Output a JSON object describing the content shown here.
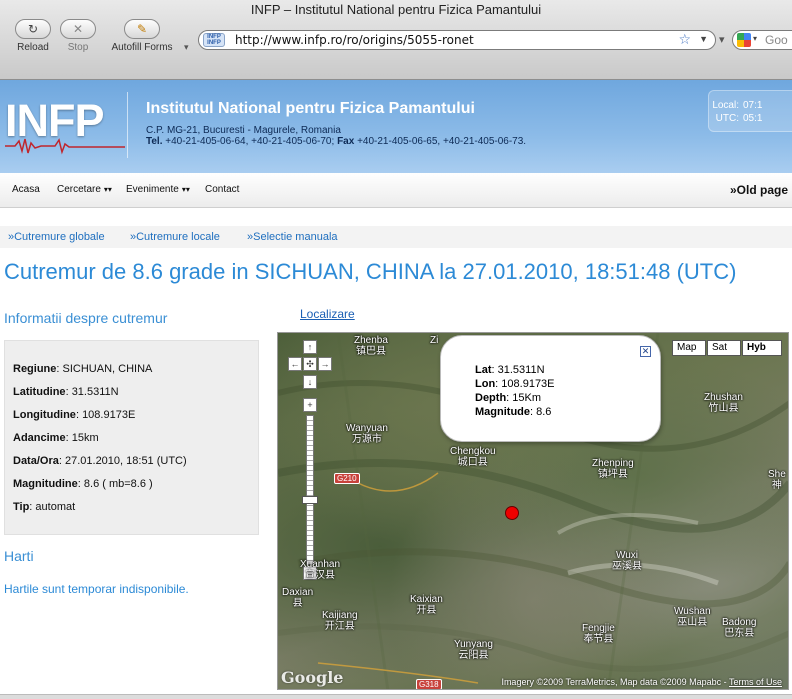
{
  "browser": {
    "window_title": "INFP – Institutul National pentru Fizica Pamantului",
    "reload_label": "Reload",
    "stop_label": "Stop",
    "autofill_label": "Autofill Forms",
    "url": "http://www.infp.ro/ro/origins/5055-ronet",
    "search_placeholder": "Goo",
    "icons": [
      "reload-icon",
      "stop-icon",
      "autofill-icon",
      "bookmark-star-icon",
      "google-icon"
    ]
  },
  "header": {
    "logo_text": "INFP",
    "institute_name": "Institutul National pentru Fizica Pamantului",
    "address": "C.P. MG-21, Bucuresti - Magurele, Romania",
    "tel_label": "Tel.",
    "tel_value": "+40-21-405-06-64, +40-21-405-06-70;",
    "fax_label": "Fax",
    "fax_value": "+40-21-405-06-65, +40-21-405-06-73.",
    "clock": {
      "local_label": "Local:",
      "local_value": "07:1",
      "utc_label": "UTC:",
      "utc_value": "05:1"
    }
  },
  "menu": {
    "items": [
      {
        "label": "Acasa"
      },
      {
        "label": "Cercetare"
      },
      {
        "label": "Evenimente"
      },
      {
        "label": "Contact"
      }
    ],
    "old_page": "»Old page"
  },
  "sub_links": [
    "»Cutremure globale",
    "»Cutremure locale",
    "»Selectie manuala"
  ],
  "page_title": "Cutremur de 8.6 grade in SICHUAN, CHINA la 27.01.2010, 18:51:48 (UTC)",
  "info": {
    "heading": "Informatii despre cutremur",
    "rows": [
      {
        "label": "Regiune",
        "value": "SICHUAN, CHINA"
      },
      {
        "label": "Latitudine",
        "value": "31.5311N"
      },
      {
        "label": "Longitudine",
        "value": "108.9173E"
      },
      {
        "label": "Adancime",
        "value": "15km"
      },
      {
        "label": "Data/Ora",
        "value": "27.01.2010, 18:51 (UTC)"
      },
      {
        "label": "Magnitudine",
        "value": "8.6 ( mb=8.6 )"
      },
      {
        "label": "Tip",
        "value": "automat"
      }
    ]
  },
  "maps": {
    "heading": "Harti",
    "text": "Hartile sunt temporar indisponibile."
  },
  "map": {
    "link_label": "Localizare",
    "type_buttons": [
      "Map",
      "Sat",
      "Hyb"
    ],
    "selected_type": "Hyb",
    "popup": [
      {
        "label": "Lat",
        "value": "31.5311N"
      },
      {
        "label": "Lon",
        "value": "108.9173E"
      },
      {
        "label": "Depth",
        "value": "15Km"
      },
      {
        "label": "Magnitude",
        "value": "8.6"
      }
    ],
    "places": [
      {
        "name": "Zhenba",
        "cn": "镇巴县"
      },
      {
        "name": "Wanyuan",
        "cn": "万源市"
      },
      {
        "name": "Chengkou",
        "cn": "城口县"
      },
      {
        "name": "Zhenping",
        "cn": "镇坪县"
      },
      {
        "name": "Zhushan",
        "cn": "竹山县"
      },
      {
        "name": "She",
        "cn": "神"
      },
      {
        "name": "Xuanhan",
        "cn": "宣汉县"
      },
      {
        "name": "Daxian",
        "cn": "县"
      },
      {
        "name": "Kaijiang",
        "cn": "开江县"
      },
      {
        "name": "Kaixian",
        "cn": "开县"
      },
      {
        "name": "Wuxi",
        "cn": "巫溪县"
      },
      {
        "name": "Fengjie",
        "cn": "奉节县"
      },
      {
        "name": "Wushan",
        "cn": "巫山县"
      },
      {
        "name": "Badong",
        "cn": "巴东县"
      },
      {
        "name": "Yunyang",
        "cn": "云阳县"
      },
      {
        "name": "Zi",
        "cn": ""
      }
    ],
    "road_badges": [
      "G210",
      "G318"
    ],
    "credit_text": "Imagery ©2009 TerraMetrics, Map data ©2009 Mapabc -",
    "terms_label": "Terms of Use",
    "google_logo": "Google",
    "colors": {
      "epicenter": "#ee0000",
      "title": "#2c8ad6",
      "link": "#1f6fbf",
      "header": "#7fb3e6"
    }
  }
}
